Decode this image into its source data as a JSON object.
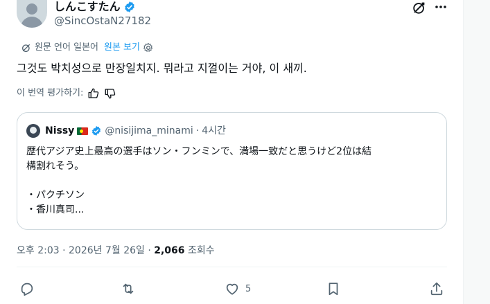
{
  "author": {
    "display_name": "しんこすたん",
    "handle": "@SincOstaN27182",
    "verified": true
  },
  "translation": {
    "notice": "원문 언어 일본어",
    "view_original": "원본 보기"
  },
  "tweet": {
    "text": "그것도 박치성으로 만장일치지. 뭐라고 지껄이는 거야, 이 새끼."
  },
  "rating": {
    "label": "이 번역 평가하기:"
  },
  "quote": {
    "name": "Nissy",
    "handle": "@nisijima_minami",
    "separator": "·",
    "time": "4시간",
    "lines": [
      "歴代アジア史上最高の選手はソン・フンミンで、満場一致だと思うけど2位は結",
      "構割れそう。",
      "",
      "・パクチソン",
      "・香川真司..."
    ]
  },
  "meta": {
    "time": "오후 2:03 · 2026년 7월 26일 · ",
    "views_count": "2,066",
    "views_label": " 조회수"
  },
  "actions": {
    "likes": "5"
  },
  "colors": {
    "accent": "#1d9bf0",
    "text": "#0f1419",
    "muted": "#536471",
    "border": "#cfd9de"
  }
}
